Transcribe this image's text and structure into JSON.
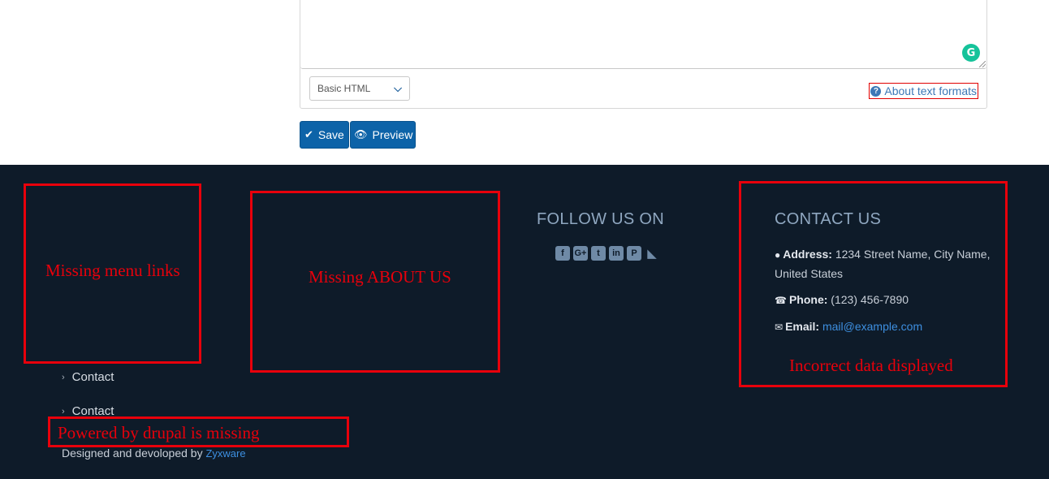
{
  "form": {
    "grammarly_icon": "G",
    "text_format": {
      "selected": "Basic HTML"
    },
    "about_text_formats": "About text formats",
    "buttons": {
      "save": "Save",
      "preview": "Preview"
    }
  },
  "footer": {
    "follow": {
      "title": "FOLLOW US ON",
      "icons": [
        "facebook-icon",
        "google-plus-icon",
        "twitter-icon",
        "linkedin-icon",
        "pinterest-icon",
        "rss-icon"
      ]
    },
    "contact": {
      "title": "CONTACT US",
      "address_label": "Address:",
      "address_line1": "1234 Street Name, City Name,",
      "address_line2": "United States",
      "phone_label": "Phone:",
      "phone": "(123) 456-7890",
      "email_label": "Email:",
      "email": "mail@example.com"
    },
    "menu": [
      "Contact",
      "Contact"
    ],
    "designed_by_text": "Designed and devoloped by",
    "designed_by_link": "Zyxware"
  },
  "annotations": {
    "menu_links": "Missing menu links",
    "about_us": "Missing ABOUT US",
    "contact_data": "Incorrect data displayed",
    "powered_by": "Powered by drupal is missing"
  },
  "colors": {
    "footer_bg": "#0e1b29",
    "button": "#0d63a8",
    "annotation_red": "#e8000b",
    "link_blue": "#3d8fe0"
  }
}
